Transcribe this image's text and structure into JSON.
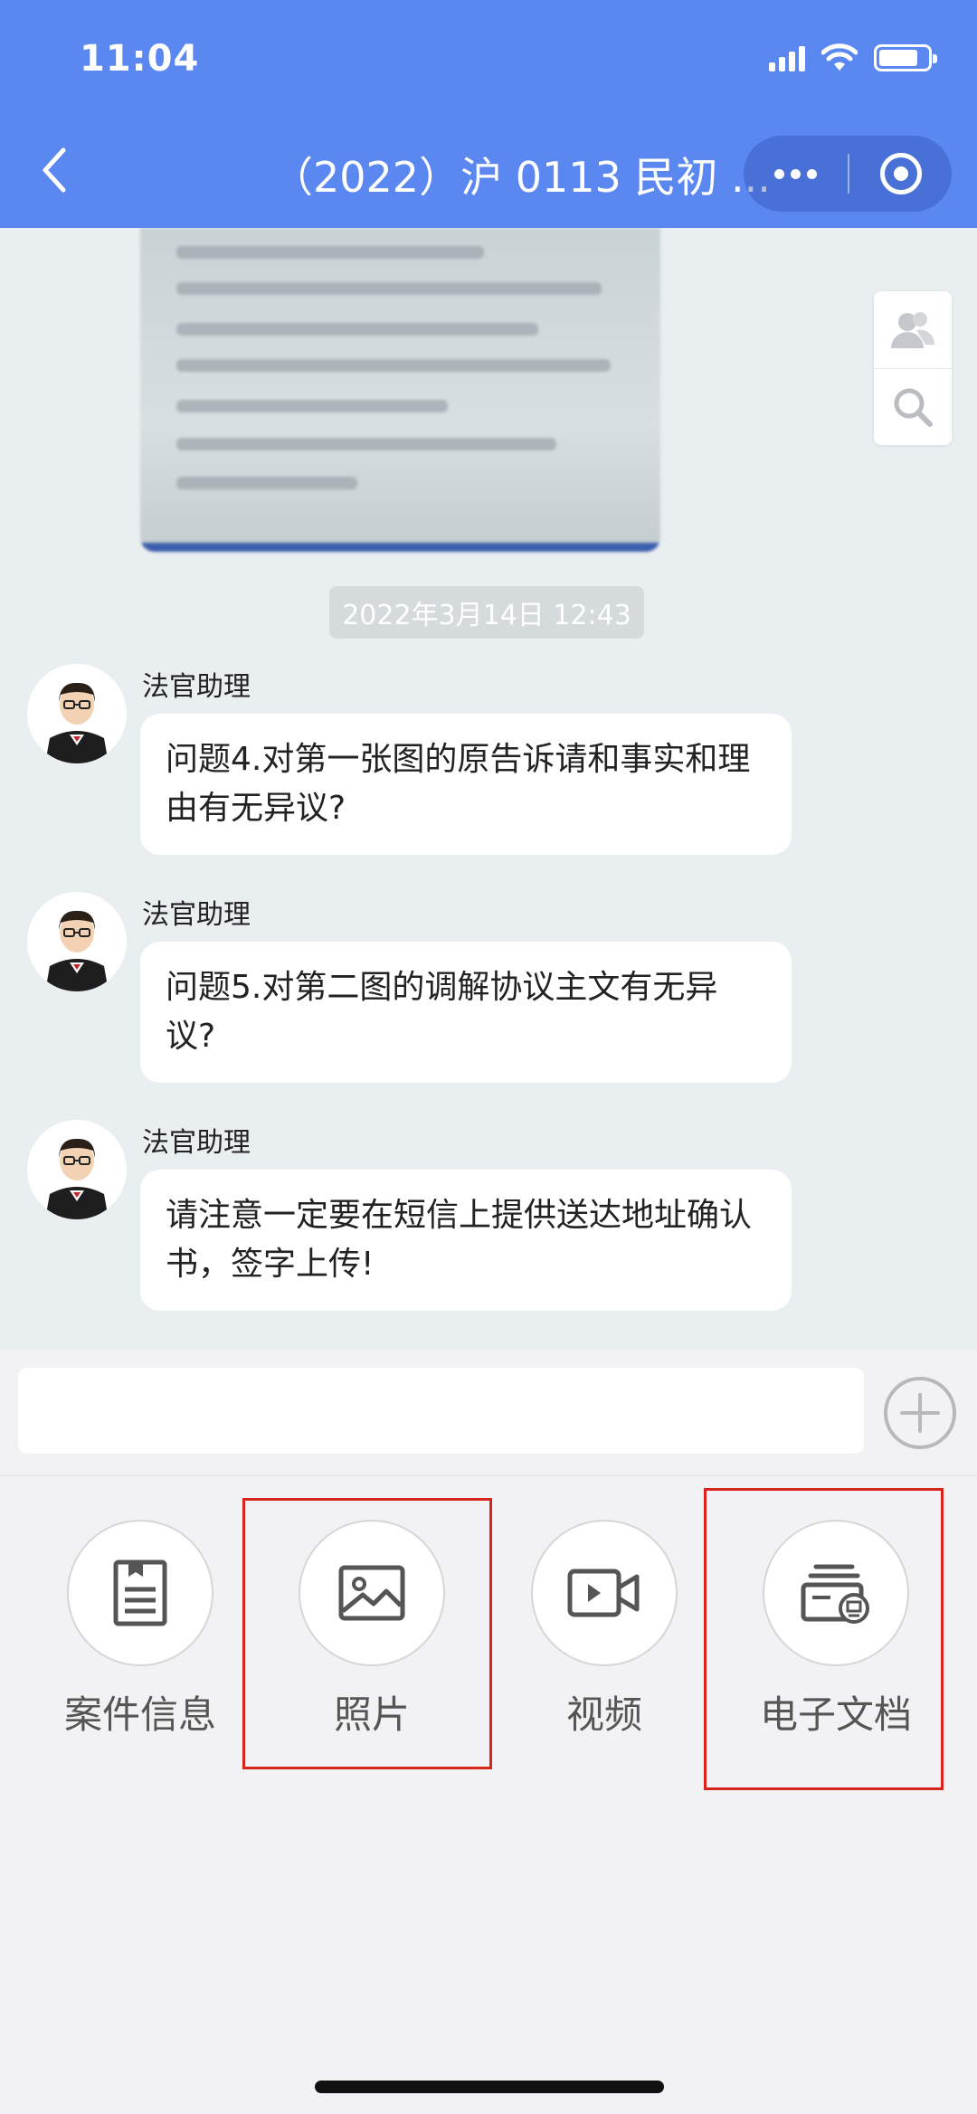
{
  "status_bar": {
    "time": "11:04"
  },
  "header": {
    "title": "（2022）沪 0113 民初 ..."
  },
  "chat": {
    "timestamp": "2022年3月14日 12:43",
    "messages": [
      {
        "sender": "法官助理",
        "text": "问题4.对第一张图的原告诉请和事实和理由有无异议?"
      },
      {
        "sender": "法官助理",
        "text": "问题5.对第二图的调解协议主文有无异议?"
      },
      {
        "sender": "法官助理",
        "text": "请注意一定要在短信上提供送达地址确认书，签字上传!"
      }
    ]
  },
  "input": {
    "placeholder": ""
  },
  "actions": [
    {
      "label": "案件信息",
      "icon": "document-icon"
    },
    {
      "label": "照片",
      "icon": "photo-icon"
    },
    {
      "label": "视频",
      "icon": "video-icon"
    },
    {
      "label": "电子文档",
      "icon": "e-document-icon"
    }
  ],
  "colors": {
    "header": "#5b87f0",
    "highlight": "#d9261c",
    "chat_bg": "#e9eef0"
  }
}
